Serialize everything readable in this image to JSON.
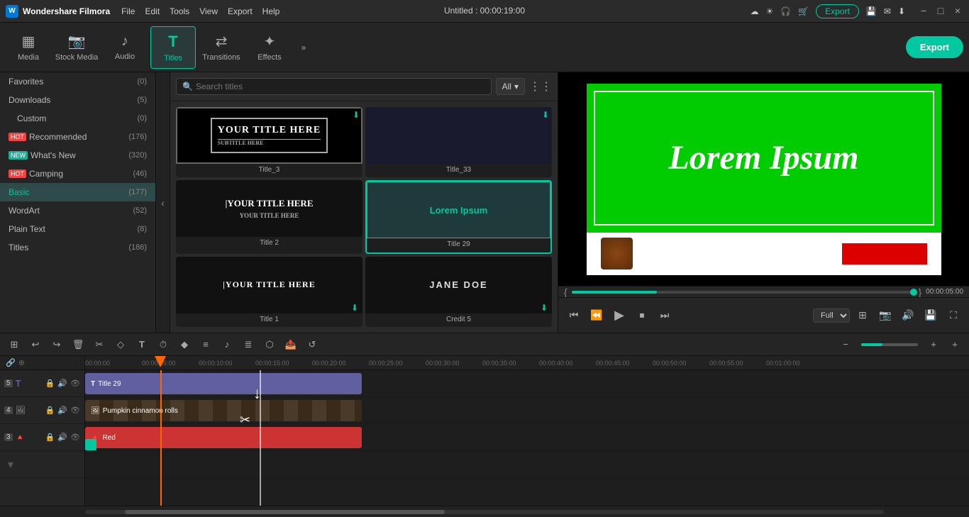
{
  "app": {
    "name": "Wondershare Filmora",
    "logo_char": "W",
    "title": "Untitled : 00:00:19:00"
  },
  "menu": {
    "items": [
      "File",
      "Edit",
      "Tools",
      "View",
      "Export",
      "Help"
    ]
  },
  "toolbar": {
    "buttons": [
      {
        "id": "media",
        "label": "Media",
        "icon": "▦"
      },
      {
        "id": "stock_media",
        "label": "Stock Media",
        "icon": "🎬"
      },
      {
        "id": "audio",
        "label": "Audio",
        "icon": "♪"
      },
      {
        "id": "titles",
        "label": "Titles",
        "icon": "T",
        "active": true
      },
      {
        "id": "transitions",
        "label": "Transitions",
        "icon": "⇄"
      },
      {
        "id": "effects",
        "label": "Effects",
        "icon": "✦"
      }
    ],
    "export_label": "Export",
    "more_icon": "»"
  },
  "sidebar": {
    "items": [
      {
        "id": "favorites",
        "label": "Favorites",
        "count": "(0)",
        "badge": null
      },
      {
        "id": "downloads",
        "label": "Downloads",
        "count": "(5)",
        "badge": null
      },
      {
        "id": "custom",
        "label": "Custom",
        "count": "(0)",
        "badge": null
      },
      {
        "id": "recommended",
        "label": "Recommended",
        "count": "(176)",
        "badge": "hot"
      },
      {
        "id": "whats_new",
        "label": "What's New",
        "count": "(320)",
        "badge": "new"
      },
      {
        "id": "camping",
        "label": "Camping",
        "count": "(46)",
        "badge": "hot"
      },
      {
        "id": "basic",
        "label": "Basic",
        "count": "(177)",
        "active": true
      },
      {
        "id": "wordart",
        "label": "WordArt",
        "count": "(52)"
      },
      {
        "id": "plain_text",
        "label": "Plain Text",
        "count": "(8)"
      },
      {
        "id": "titles",
        "label": "Titles",
        "count": "(186)"
      }
    ]
  },
  "titles_panel": {
    "search_placeholder": "Search titles",
    "filter_label": "All",
    "cards": [
      {
        "id": "title_3",
        "label": "Title_3",
        "preview_type": "white_box",
        "preview_text": "YOUR TITLE HERE",
        "has_download": true
      },
      {
        "id": "title_33",
        "label": "Title_33",
        "preview_type": "dark",
        "preview_text": "",
        "has_download": true
      },
      {
        "id": "title_2",
        "label": "Title 2",
        "preview_type": "white_box2",
        "preview_text": "YOUR TITLE HERE",
        "selected": false
      },
      {
        "id": "title_29",
        "label": "Title 29",
        "preview_type": "teal_box",
        "preview_text": "Lorem Ipsum",
        "selected": true
      },
      {
        "id": "title_1",
        "label": "Title 1",
        "preview_type": "dark_bar",
        "preview_text": "|YOUR TITLE HERE",
        "has_download": false
      },
      {
        "id": "credit_5",
        "label": "Credit 5",
        "preview_type": "text_only",
        "preview_text": "JANE DOE",
        "has_download": true
      }
    ]
  },
  "preview": {
    "lorem_text": "Lorem Ipsum",
    "time_current": "00:00:05:00",
    "time_total": "00:00:05:00",
    "zoom_level": "Full",
    "controls": {
      "skip_back": "⏮",
      "step_back": "⏪",
      "play": "▶",
      "stop": "⏹",
      "skip_fwd": "⏭"
    },
    "brackets_open": "{",
    "brackets_close": "}"
  },
  "timeline": {
    "toolbar_buttons": [
      "⊞",
      "↩",
      "↪",
      "🗑",
      "✂",
      "◇",
      "T",
      "⏱",
      "◆",
      "≡",
      "♪",
      "≣",
      "⬡",
      "📤",
      "↺"
    ],
    "zoom_minus": "−",
    "zoom_plus": "+",
    "link_icon": "🔗",
    "snap_icon": "⊕",
    "ruler_marks": [
      "00:00:00",
      "00:00:05:00",
      "00:00:10:00",
      "00:00:15:00",
      "00:00:20:00",
      "00:00:25:00",
      "00:00:30:00",
      "00:00:35:00",
      "00:00:40:00",
      "00:00:45:00",
      "00:00:50:00",
      "00:00:55:00",
      "00:01:00:00"
    ],
    "tracks": [
      {
        "num": "5",
        "type": "title",
        "label": "Title 29",
        "icons": [
          "T",
          "🔒",
          "🔊",
          "👁"
        ],
        "clip_color": "#6060a0"
      },
      {
        "num": "4",
        "type": "video",
        "label": "Pumpkin cinnamon rolls",
        "icons": [
          "🖼",
          "🔒",
          "🔊",
          "👁"
        ],
        "clip_color": "#4a3020"
      },
      {
        "num": "3",
        "type": "red",
        "label": "Red",
        "icons": [
          "🔺",
          "🔒",
          "🔊",
          "👁"
        ],
        "clip_color": "#cc3333"
      }
    ],
    "playhead_time": "00:00:05:00"
  },
  "win_controls": {
    "minimize": "−",
    "maximize": "□",
    "close": "×"
  },
  "header_icons": [
    "☀",
    "☎",
    "🛒"
  ],
  "colors": {
    "accent": "#00c8a0",
    "playhead": "#ff6600",
    "green_screen": "#00cc00",
    "red_clip": "#cc3333",
    "title_clip": "#6060a0"
  }
}
